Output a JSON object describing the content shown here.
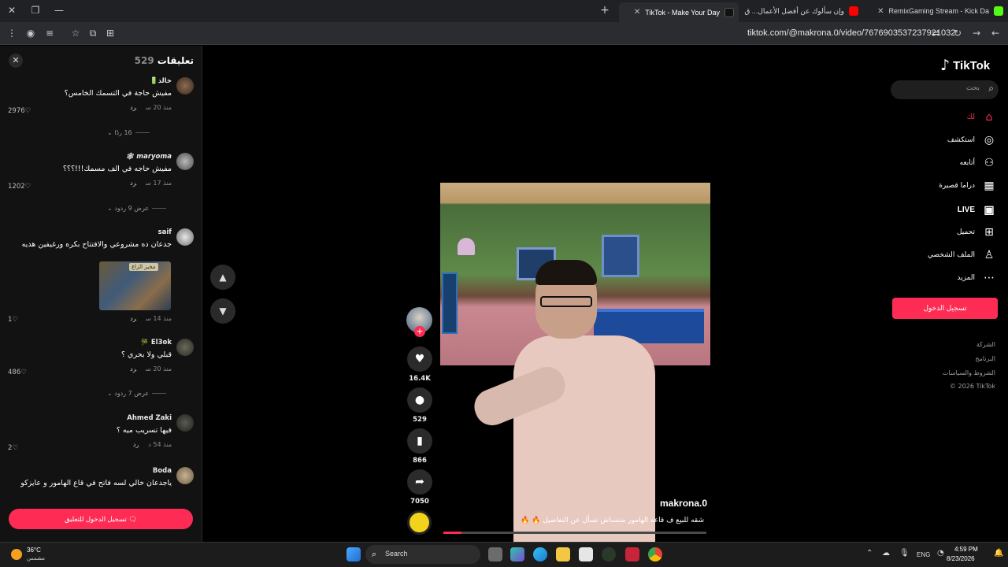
{
  "browser": {
    "tabs": [
      {
        "title": "RemixGaming Stream - Kick Da",
        "favicon_color": "#53fc18"
      },
      {
        "title": "وإن سألوك عن أفضل الأعمال... ق",
        "favicon_color": "#ff0000"
      },
      {
        "title": "TikTok - Make Your Day",
        "favicon_color": "#111111"
      }
    ],
    "url": "tiktok.com/@makrona.0/video/7676903537237921032"
  },
  "sidebar": {
    "logo_text": "TikTok",
    "search_placeholder": "بحث",
    "items": [
      {
        "label": "لك",
        "icon": "home-icon",
        "active": true
      },
      {
        "label": "استكشف",
        "icon": "compass-icon",
        "active": false
      },
      {
        "label": "أتابعه",
        "icon": "following-icon",
        "active": false
      },
      {
        "label": "دراما قصيرة",
        "icon": "film-icon",
        "active": false
      },
      {
        "label": "LIVE",
        "icon": "live-tv-icon",
        "active": false
      },
      {
        "label": "تحميل",
        "icon": "upload-icon",
        "active": false
      },
      {
        "label": "الملف الشخصي",
        "icon": "profile-icon",
        "active": false
      },
      {
        "label": "المزيد",
        "icon": "more-icon",
        "active": false
      }
    ],
    "login_label": "تسجيل الدخول",
    "footer": [
      "الشركة",
      "البرنامج",
      "الشروط والسياسات",
      "© 2026 TikTok"
    ]
  },
  "comments": {
    "title": "تعليقات",
    "count": "529",
    "reply_label": "رد",
    "items": [
      {
        "user": "خالد🔋",
        "text": "مفيش حاجة في التسمك الخامس؟",
        "time": "منذ 20 س",
        "likes": "2976",
        "replies": "16 ردًا"
      },
      {
        "user": "maryoma 🕸",
        "text": "مفيش حاجه في الف مسمك!!!؟؟؟",
        "time": "منذ 17 س",
        "likes": "1202",
        "replies": "عرض 9 ردود"
      },
      {
        "user": "saif",
        "text": "جدعان ده مشروعي والافتتاح بكره ورغيفين هديه",
        "time": "منذ 14 س",
        "likes": "1",
        "image_label": "مخبز الزاغ"
      },
      {
        "user": "El3ok 🎋",
        "text": "قبلي ولا بحري ؟",
        "time": "منذ 20 س",
        "likes": "486",
        "replies": "عرض 7 ردود"
      },
      {
        "user": "Ahmed Zaki",
        "text": "فيها تسريب ميه ؟",
        "time": "منذ 54 د",
        "likes": "2"
      },
      {
        "user": "Boda",
        "text": "ياجدعان خالي لسه فاتح في قاع الهامور و عايزكو"
      }
    ],
    "login_to_comment": "تسجيل الدخول للتعليق"
  },
  "video": {
    "author": "makrona.0",
    "caption": "شقه للبيع ف قاعه الهامور متنساش تسأل عن التفاصيل 🔥 🔥",
    "stats": {
      "likes": "16.4K",
      "comments": "529",
      "saves": "866",
      "shares": "7050"
    },
    "progress": 0.07
  },
  "taskbar": {
    "weather_temp": "36°C",
    "weather_desc": "مشمس",
    "search_label": "Search",
    "lang": "ENG",
    "time": "4:59 PM",
    "date": "8/23/2026"
  },
  "colors": {
    "accent": "#fe2c55",
    "bg": "#000000",
    "panel": "#121212"
  }
}
